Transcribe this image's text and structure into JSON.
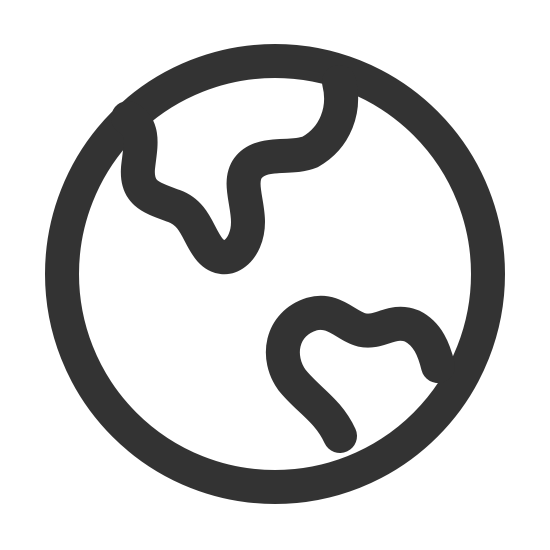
{
  "icon": {
    "name": "globe-icon",
    "color": "#333333",
    "background": "#ffffff"
  }
}
